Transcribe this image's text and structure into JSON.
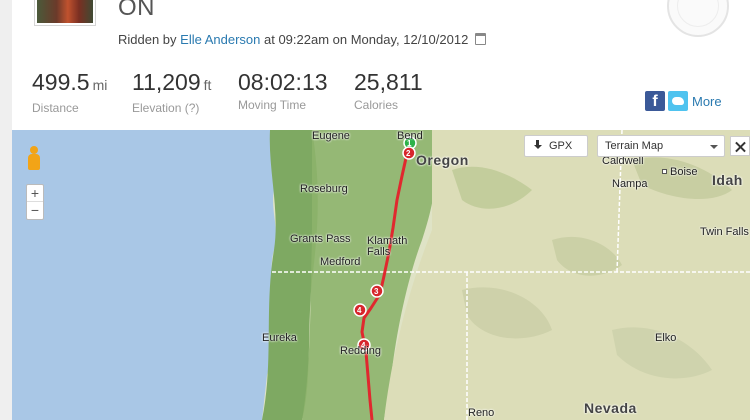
{
  "activity": {
    "title": "ON",
    "ridden_prefix": "Ridden by ",
    "rider": "Elle Anderson",
    "ridden_suffix": " at 09:22am on Monday, 12/10/2012"
  },
  "stats": [
    {
      "value": "499.5",
      "unit": "mi",
      "label": "Distance"
    },
    {
      "value": "11,209",
      "unit": "ft",
      "label": "Elevation (?)"
    },
    {
      "value": "08:02:13",
      "unit": "",
      "label": "Moving Time"
    },
    {
      "value": "25,811",
      "unit": "",
      "label": "Calories"
    }
  ],
  "social": {
    "facebook": "f",
    "more": "More"
  },
  "map": {
    "gpx_label": "GPX",
    "map_type": "Terrain Map",
    "zoom_in": "+",
    "zoom_out": "−",
    "labels": {
      "eugene": "Eugene",
      "bend": "Bend",
      "oregon": "Oregon",
      "caldwell": "Caldwell",
      "boise": "Boise",
      "idaho": "Idah",
      "nampa": "Nampa",
      "roseburg": "Roseburg",
      "grants_pass": "Grants Pass",
      "klamath_falls": "Klamath\nFalls",
      "medford": "Medford",
      "twin_falls": "Twin Falls",
      "eureka": "Eureka",
      "redding": "Redding",
      "elko": "Elko",
      "reno": "Reno",
      "nevada": "Nevada"
    },
    "markers": [
      "1",
      "2",
      "3",
      "4",
      "4"
    ],
    "route_color": "#e0282e",
    "marker_color": "#d7262c",
    "start_color": "#2db24a"
  }
}
